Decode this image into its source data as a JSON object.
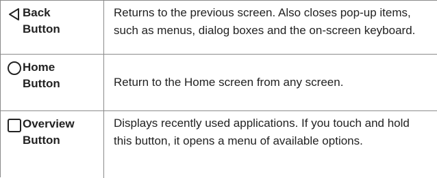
{
  "rows": [
    {
      "icon": "back-triangle-icon",
      "label": "Back\nButton",
      "description": "Returns to the previous screen. Also closes pop-up items, such as menus, dialog boxes and the on-screen keyboard."
    },
    {
      "icon": "home-circle-icon",
      "label": "Home\nButton",
      "description": "Return to the Home screen from any screen."
    },
    {
      "icon": "overview-square-icon",
      "label": "Overview\nButton",
      "description": "Displays recently used applications. If you touch and hold this button, it opens a menu of available options."
    }
  ],
  "colors": {
    "border": "#8a8a8a",
    "text": "#222222"
  }
}
